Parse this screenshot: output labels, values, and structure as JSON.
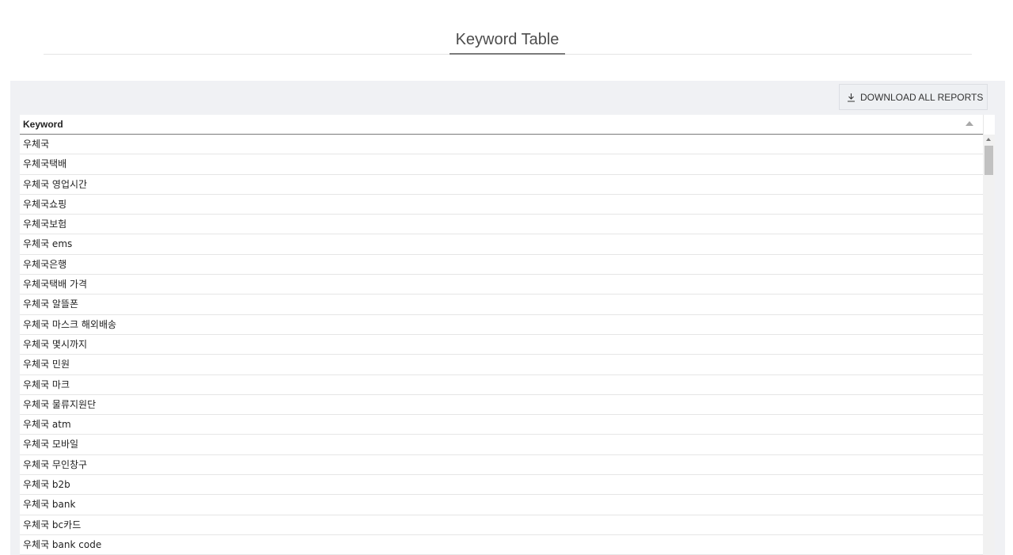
{
  "header": {
    "title": "Keyword Table"
  },
  "toolbar": {
    "download_label": "DOWNLOAD ALL REPORTS",
    "download_icon": "download-icon"
  },
  "table": {
    "column_header": "Keyword",
    "sort_icon": "sort-ascending-icon",
    "rows": [
      "우체국",
      "우체국택배",
      "우체국 영업시간",
      "우체국쇼핑",
      "우체국보험",
      "우체국 ems",
      "우체국은행",
      "우체국택배 가격",
      "우체국 알뜰폰",
      "우체국 마스크 해외배송",
      "우체국 몇시까지",
      "우체국 민원",
      "우체국 마크",
      "우체국 물류지원단",
      "우체국 atm",
      "우체국 모바일",
      "우체국 무인창구",
      "우체국 b2b",
      "우체국 bank",
      "우체국 bc카드",
      "우체국 bank code"
    ]
  },
  "colors": {
    "panel_bg": "#f0f1f4",
    "header_underline": "#7a7a7a",
    "row_border": "#e6e6e6"
  }
}
